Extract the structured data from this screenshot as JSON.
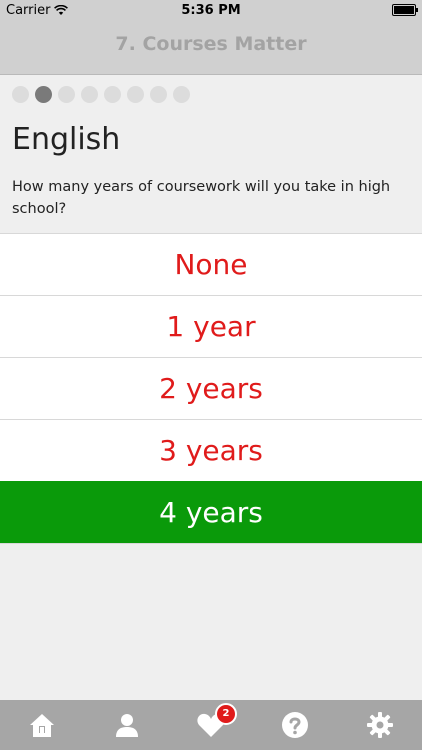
{
  "status_bar": {
    "carrier": "Carrier",
    "time": "5:36 PM"
  },
  "nav": {
    "title": "7. Courses Matter"
  },
  "progress": {
    "total_steps": 8,
    "current_step": 2
  },
  "question": {
    "subject": "English",
    "text": "How many years of coursework will you take in high school?"
  },
  "options": [
    {
      "label": "None",
      "selected": false
    },
    {
      "label": "1 year",
      "selected": false
    },
    {
      "label": "2 years",
      "selected": false
    },
    {
      "label": "3 years",
      "selected": false
    },
    {
      "label": "4 years",
      "selected": true
    }
  ],
  "tabbar": {
    "items": [
      {
        "icon": "home-icon"
      },
      {
        "icon": "profile-icon"
      },
      {
        "icon": "favorites-heart-icon",
        "badge": "2"
      },
      {
        "icon": "help-icon"
      },
      {
        "icon": "settings-gear-icon"
      }
    ]
  },
  "colors": {
    "answer_text": "#e01b1b",
    "selected_bg": "#0a9a0a",
    "nav_bg": "#d0d0d0",
    "tabbar_bg": "#a6a6a6"
  }
}
